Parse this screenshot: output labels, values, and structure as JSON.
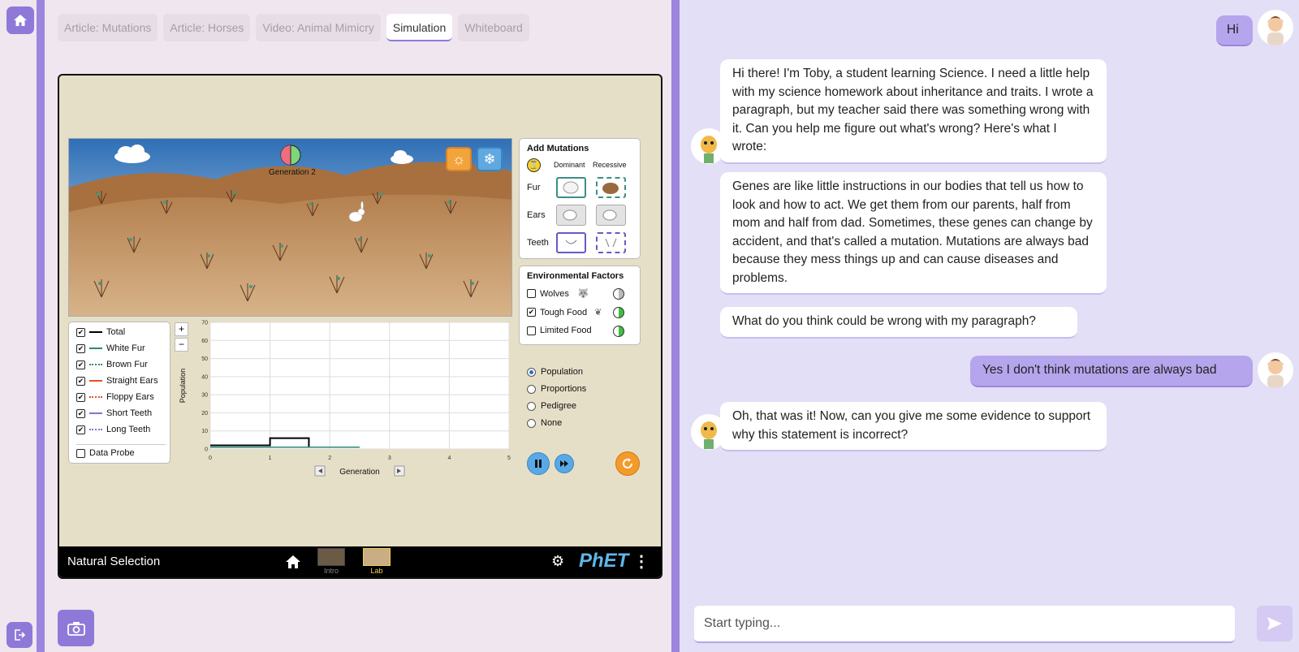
{
  "tabs": [
    {
      "label": "Article: Mutations"
    },
    {
      "label": "Article: Horses"
    },
    {
      "label": "Video: Animal Mimicry"
    },
    {
      "label": "Simulation"
    },
    {
      "label": "Whiteboard"
    }
  ],
  "sim": {
    "generation_label": "Generation 2",
    "mutations": {
      "title": "Add Mutations",
      "dominant": "Dominant",
      "recessive": "Recessive",
      "rows": [
        {
          "label": "Fur"
        },
        {
          "label": "Ears"
        },
        {
          "label": "Teeth"
        }
      ]
    },
    "env": {
      "title": "Environmental Factors",
      "items": [
        {
          "label": "Wolves",
          "checked": false
        },
        {
          "label": "Tough Food",
          "checked": true
        },
        {
          "label": "Limited Food",
          "checked": false
        }
      ]
    },
    "legend": {
      "items": [
        {
          "label": "Total",
          "color": "#000000",
          "style": "solid"
        },
        {
          "label": "White Fur",
          "color": "#2a8a78",
          "style": "solid"
        },
        {
          "label": "Brown Fur",
          "color": "#2a8a78",
          "style": "dotted"
        },
        {
          "label": "Straight Ears",
          "color": "#e2531f",
          "style": "solid"
        },
        {
          "label": "Floppy Ears",
          "color": "#e2531f",
          "style": "dotted"
        },
        {
          "label": "Short Teeth",
          "color": "#8a6fd6",
          "style": "solid"
        },
        {
          "label": "Long Teeth",
          "color": "#8a6fd6",
          "style": "dotted"
        }
      ],
      "probe": "Data Probe"
    },
    "zoom_in": "+",
    "zoom_out": "−",
    "graph_modes": [
      {
        "label": "Population",
        "selected": true
      },
      {
        "label": "Proportions",
        "selected": false
      },
      {
        "label": "Pedigree",
        "selected": false
      },
      {
        "label": "None",
        "selected": false
      }
    ],
    "navbar": {
      "title": "Natural Selection",
      "screens": [
        {
          "label": "Intro"
        },
        {
          "label": "Lab"
        }
      ],
      "brand": "PhET"
    }
  },
  "chart_data": {
    "type": "line",
    "xlabel": "Generation",
    "ylabel": "Population",
    "xlim": [
      0,
      5
    ],
    "ylim": [
      0,
      70
    ],
    "xticks": [
      0,
      1,
      2,
      3,
      4,
      5
    ],
    "yticks": [
      0,
      10,
      20,
      30,
      40,
      50,
      60,
      70
    ],
    "grid": true,
    "series": [
      {
        "name": "Total",
        "x": [
          0,
          1,
          1,
          1.65,
          1.65
        ],
        "y": [
          2,
          2,
          6,
          6,
          1
        ]
      },
      {
        "name": "White Fur",
        "x": [
          0,
          2.5
        ],
        "y": [
          1,
          1
        ]
      }
    ]
  },
  "chat": {
    "messages": [
      {
        "role": "user",
        "text": "Hi"
      },
      {
        "role": "bot",
        "text": "Hi there! I'm Toby, a student learning Science. I need a little help with my science homework about inheritance and traits. I wrote a paragraph, but my teacher said there was something wrong with it. Can you help me figure out what's wrong? Here's what I wrote:"
      },
      {
        "role": "bot",
        "text": "Genes are like little instructions in our bodies that tell us how to look and how to act. We get them from our parents, half from mom and half from dad. Sometimes, these genes can change by accident, and that's called a mutation. Mutations are always bad because they mess things up and can cause diseases and problems."
      },
      {
        "role": "bot",
        "text": "What do you think could be wrong with my paragraph?"
      },
      {
        "role": "user",
        "text": "Yes I don't think mutations are always bad"
      },
      {
        "role": "bot",
        "text": "Oh, that was it! Now, can you give me some evidence to support why this statement is incorrect?"
      }
    ],
    "input_placeholder": "Start typing..."
  },
  "colors": {
    "accent": "#8e79d8",
    "chat_bg": "#e3dff6",
    "user_bubble": "#b5a5ec"
  }
}
